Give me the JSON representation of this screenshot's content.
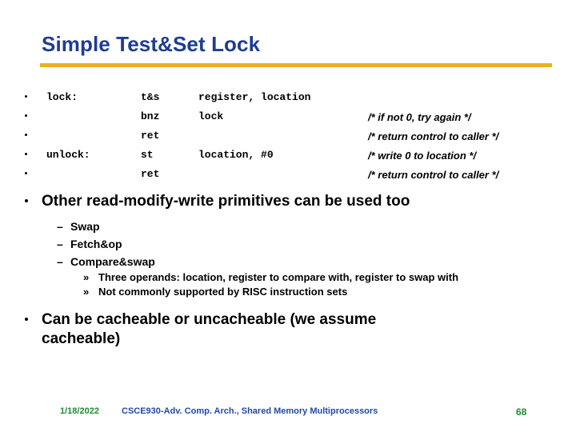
{
  "slide": {
    "title": "Simple Test&Set Lock",
    "accent_rule_color": "#edb021",
    "title_color": "#1f3c93"
  },
  "code": {
    "lines": [
      {
        "label": "lock:",
        "op": "t&s",
        "args": "register, location",
        "comment": ""
      },
      {
        "label": "",
        "op": "bnz",
        "args": "lock",
        "comment": "/* if not 0, try again */"
      },
      {
        "label": "",
        "op": "ret",
        "args": "",
        "comment": "/* return control to caller */"
      },
      {
        "label": "unlock:",
        "op": "st",
        "args": "location, #0",
        "comment": "/* write 0 to location */"
      },
      {
        "label": "",
        "op": "ret",
        "args": "",
        "comment": "/* return control to caller */"
      }
    ]
  },
  "body": {
    "bullet1": "Other read-modify-write primitives can be used too",
    "sub": [
      "Swap",
      "Fetch&op",
      "Compare&swap"
    ],
    "subsub": [
      "Three operands: location, register to compare with, register to swap with",
      "Not commonly supported by RISC instruction sets"
    ],
    "bullet2": "Can be cacheable or uncacheable (we assume cacheable)",
    "marker_dash": "–",
    "marker_guillemet": "»"
  },
  "footer": {
    "date": "1/18/2022",
    "center": "CSCE930-Adv. Comp. Arch., Shared Memory Multiprocessors",
    "page": "68",
    "date_color": "#1f8a32",
    "center_color": "#2349a6"
  }
}
